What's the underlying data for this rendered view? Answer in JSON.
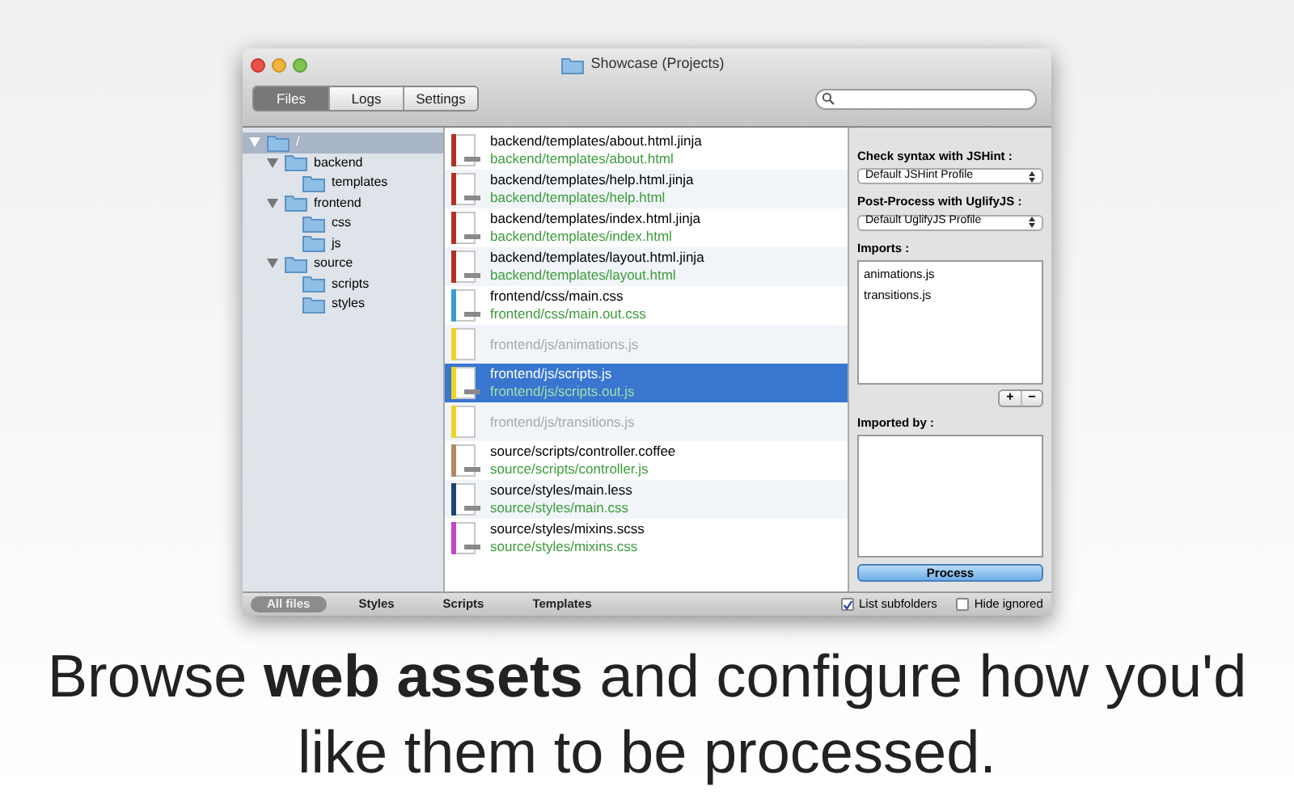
{
  "window": {
    "title": "Showcase (Projects)"
  },
  "tabs": [
    {
      "label": "Files",
      "selected": true
    },
    {
      "label": "Logs",
      "selected": false
    },
    {
      "label": "Settings",
      "selected": false
    }
  ],
  "tree": [
    {
      "label": "/",
      "selected": true,
      "expanded": true,
      "children": [
        {
          "label": "backend",
          "selected": false,
          "expanded": true,
          "children": [
            {
              "label": "templates",
              "selected": false
            }
          ]
        },
        {
          "label": "frontend",
          "selected": false,
          "expanded": true,
          "children": [
            {
              "label": "css",
              "selected": false
            },
            {
              "label": "js",
              "selected": false
            }
          ]
        },
        {
          "label": "source",
          "selected": false,
          "expanded": true,
          "children": [
            {
              "label": "scripts",
              "selected": false
            },
            {
              "label": "styles",
              "selected": false
            }
          ]
        }
      ]
    }
  ],
  "files": [
    {
      "name": "backend/templates/about.html.jinja",
      "output": "backend/templates/about.html",
      "color": "#b3321f",
      "ignored": false,
      "selected": false
    },
    {
      "name": "backend/templates/help.html.jinja",
      "output": "backend/templates/help.html",
      "color": "#b3321f",
      "ignored": false,
      "selected": false
    },
    {
      "name": "backend/templates/index.html.jinja",
      "output": "backend/templates/index.html",
      "color": "#b3321f",
      "ignored": false,
      "selected": false
    },
    {
      "name": "backend/templates/layout.html.jinja",
      "output": "backend/templates/layout.html",
      "color": "#b3321f",
      "ignored": false,
      "selected": false
    },
    {
      "name": "frontend/css/main.css",
      "output": "frontend/css/main.out.css",
      "color": "#3a9bd5",
      "ignored": false,
      "selected": false
    },
    {
      "name": "frontend/js/animations.js",
      "color": "#f0d424",
      "ignored": true,
      "selected": false
    },
    {
      "name": "frontend/js/scripts.js",
      "output": "frontend/js/scripts.out.js",
      "color": "#f0d424",
      "ignored": false,
      "selected": true
    },
    {
      "name": "frontend/js/transitions.js",
      "color": "#f0d424",
      "ignored": true,
      "selected": false
    },
    {
      "name": "source/scripts/controller.coffee",
      "output": "source/scripts/controller.js",
      "color": "#b08a62",
      "ignored": false,
      "selected": false
    },
    {
      "name": "source/styles/main.less",
      "output": "source/styles/main.css",
      "color": "#1f4272",
      "ignored": false,
      "selected": false
    },
    {
      "name": "source/styles/mixins.scss",
      "output": "source/styles/mixins.css",
      "color": "#c345c8",
      "ignored": false,
      "selected": false
    }
  ],
  "inspector": {
    "syntax_label": "Check syntax with JSHint :",
    "syntax_value": "Default JSHint Profile",
    "post_label": "Post-Process with UglifyJS :",
    "post_value": "Default UglifyJS Profile",
    "imports_label": "Imports :",
    "imports": [
      "animations.js",
      "transitions.js"
    ],
    "add": "+",
    "remove": "−",
    "imported_by_label": "Imported by :",
    "process": "Process"
  },
  "filters": [
    {
      "label": "All files",
      "selected": true
    },
    {
      "label": "Styles",
      "selected": false
    },
    {
      "label": "Scripts",
      "selected": false
    },
    {
      "label": "Templates",
      "selected": false
    }
  ],
  "options": [
    {
      "label": "List subfolders",
      "checked": true
    },
    {
      "label": "Hide ignored",
      "checked": false
    }
  ],
  "caption": "Browse **web assets** and configure how you'd like them to be processed."
}
